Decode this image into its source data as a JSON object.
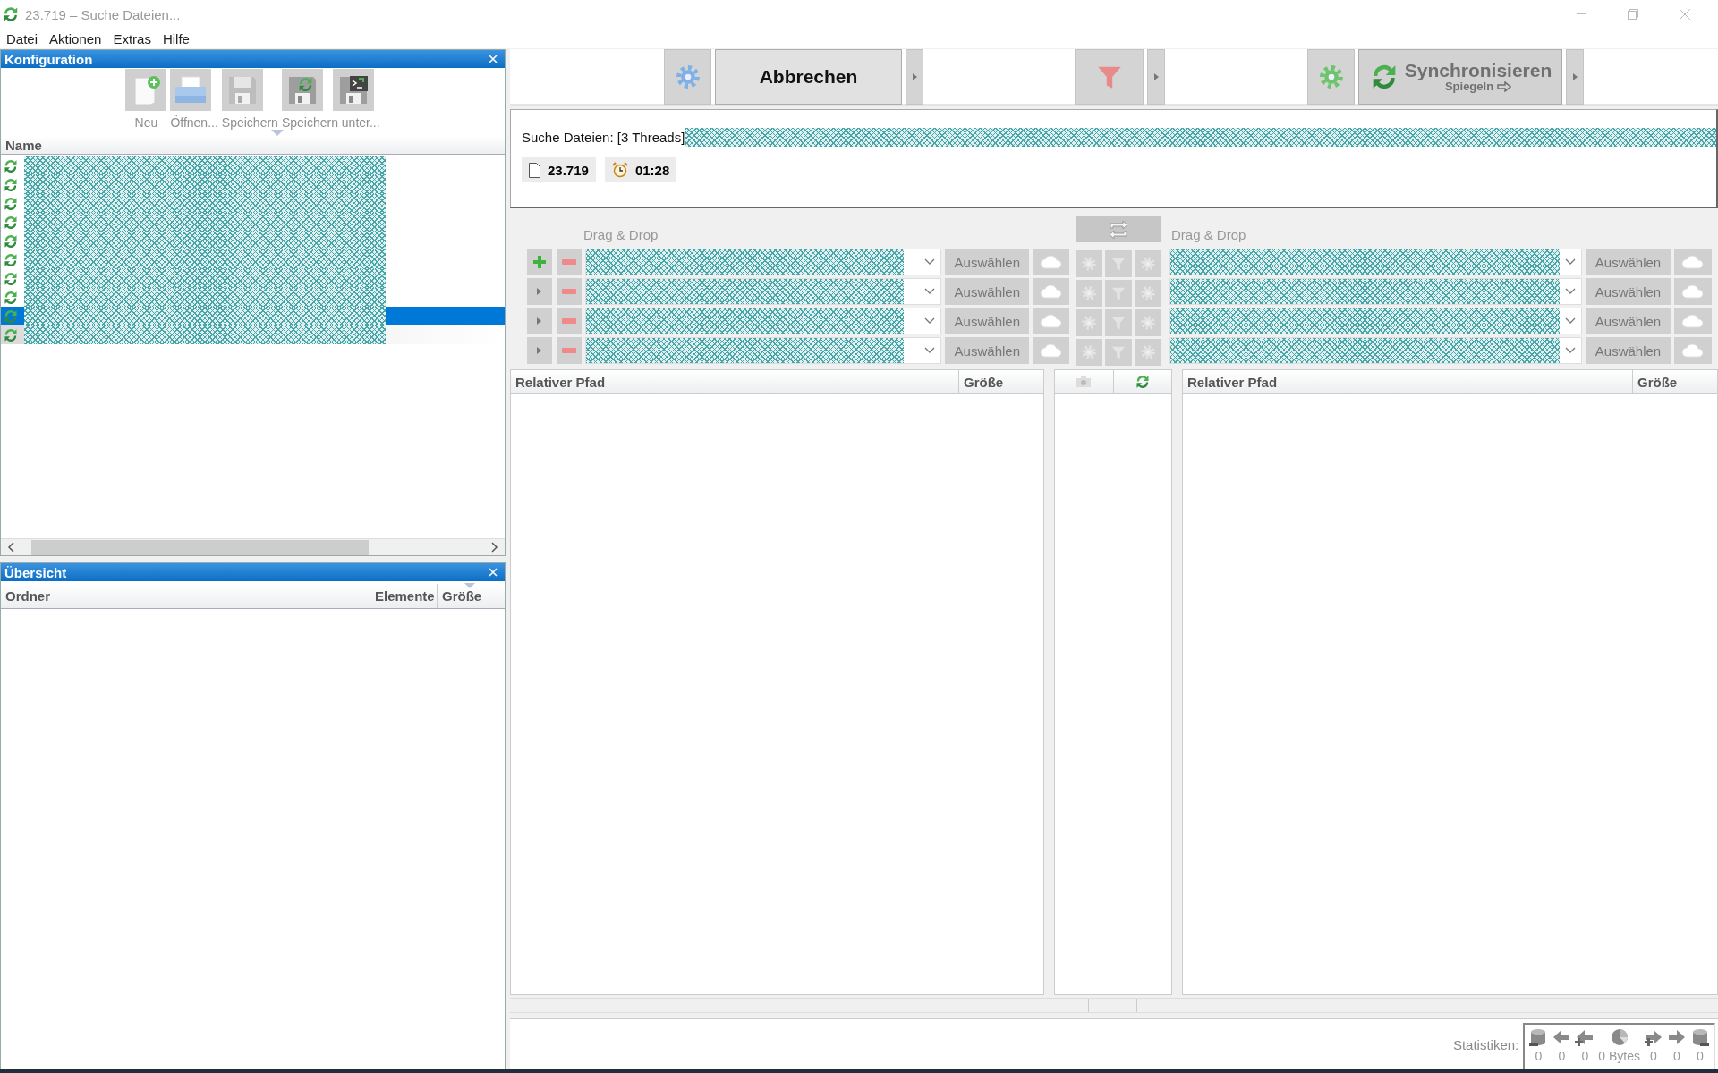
{
  "window": {
    "title": "23.719 – Suche Dateien..."
  },
  "menu": [
    {
      "label": "Datei"
    },
    {
      "label": "Aktionen"
    },
    {
      "label": "Extras"
    },
    {
      "label": "Hilfe"
    }
  ],
  "config_panel": {
    "title": "Konfiguration",
    "toolbar": [
      {
        "kind": "new",
        "label": "Neu",
        "disabled": true
      },
      {
        "kind": "open",
        "label": "Öffnen...",
        "disabled": true
      },
      {
        "kind": "save",
        "label": "Speichern",
        "disabled": true
      },
      {
        "kind": "save_as",
        "label": "Speichern unter...",
        "disabled": true
      },
      {
        "kind": "batch",
        "disabled": true
      }
    ],
    "column": "Name",
    "names_redacted": true,
    "rows": [
      {
        "selected": false,
        "highlighted": false
      },
      {
        "selected": false,
        "highlighted": false
      },
      {
        "selected": false,
        "highlighted": false
      },
      {
        "selected": false,
        "highlighted": false
      },
      {
        "selected": false,
        "highlighted": false
      },
      {
        "selected": false,
        "highlighted": false
      },
      {
        "selected": false,
        "highlighted": false
      },
      {
        "selected": false,
        "highlighted": false
      },
      {
        "selected": true,
        "highlighted": false
      },
      {
        "selected": false,
        "highlighted": true
      }
    ]
  },
  "overview_panel": {
    "title": "Übersicht",
    "columns": [
      "Ordner",
      "Elemente",
      "Größe"
    ]
  },
  "toolbar": {
    "compare": [
      {
        "kind": "settings",
        "disabled": false
      },
      {
        "kind": "command",
        "label": "Abbrechen",
        "disabled": false
      },
      {
        "kind": "menu",
        "disabled": false
      }
    ],
    "filter": [
      {
        "kind": "filter",
        "disabled": false
      },
      {
        "kind": "menu",
        "disabled": false
      }
    ],
    "synchronize": [
      {
        "kind": "settings",
        "disabled": false
      },
      {
        "kind": "command",
        "label": "Synchronisieren",
        "sublabel": "Spiegeln",
        "disabled": true
      },
      {
        "kind": "menu",
        "disabled": false
      }
    ]
  },
  "status": {
    "text": "Suche Dateien: [3 Threads]",
    "detail_redacted": true,
    "counters": [
      {
        "kind": "files",
        "value": "23.719"
      },
      {
        "kind": "time",
        "value": "01:28"
      }
    ]
  },
  "folder_pairs": {
    "left_label": "Drag & Drop",
    "right_label": "Drag & Drop",
    "paths_redacted": true,
    "rows": [
      {
        "kind": "main",
        "left_browse": "Auswählen",
        "right_browse": "Auswählen"
      },
      {
        "kind": "additional",
        "left_browse": "Auswählen",
        "right_browse": "Auswählen"
      },
      {
        "kind": "additional",
        "left_browse": "Auswählen",
        "right_browse": "Auswählen"
      },
      {
        "kind": "additional",
        "left_browse": "Auswählen",
        "right_browse": "Auswählen"
      }
    ]
  },
  "grids": {
    "left": {
      "columns": [
        "Relativer Pfad",
        "Größe"
      ]
    },
    "right": {
      "columns": [
        "Relativer Pfad",
        "Größe"
      ]
    }
  },
  "statistics": {
    "label": "Statistiken:",
    "items": [
      {
        "kind": "delete_left",
        "value": "0"
      },
      {
        "kind": "update_left",
        "value": "0"
      },
      {
        "kind": "create_left",
        "value": "0"
      },
      {
        "kind": "data",
        "value": "0 Bytes"
      },
      {
        "kind": "create_right",
        "value": "0"
      },
      {
        "kind": "update_right",
        "value": "0"
      },
      {
        "kind": "delete_right",
        "value": "0"
      }
    ]
  }
}
